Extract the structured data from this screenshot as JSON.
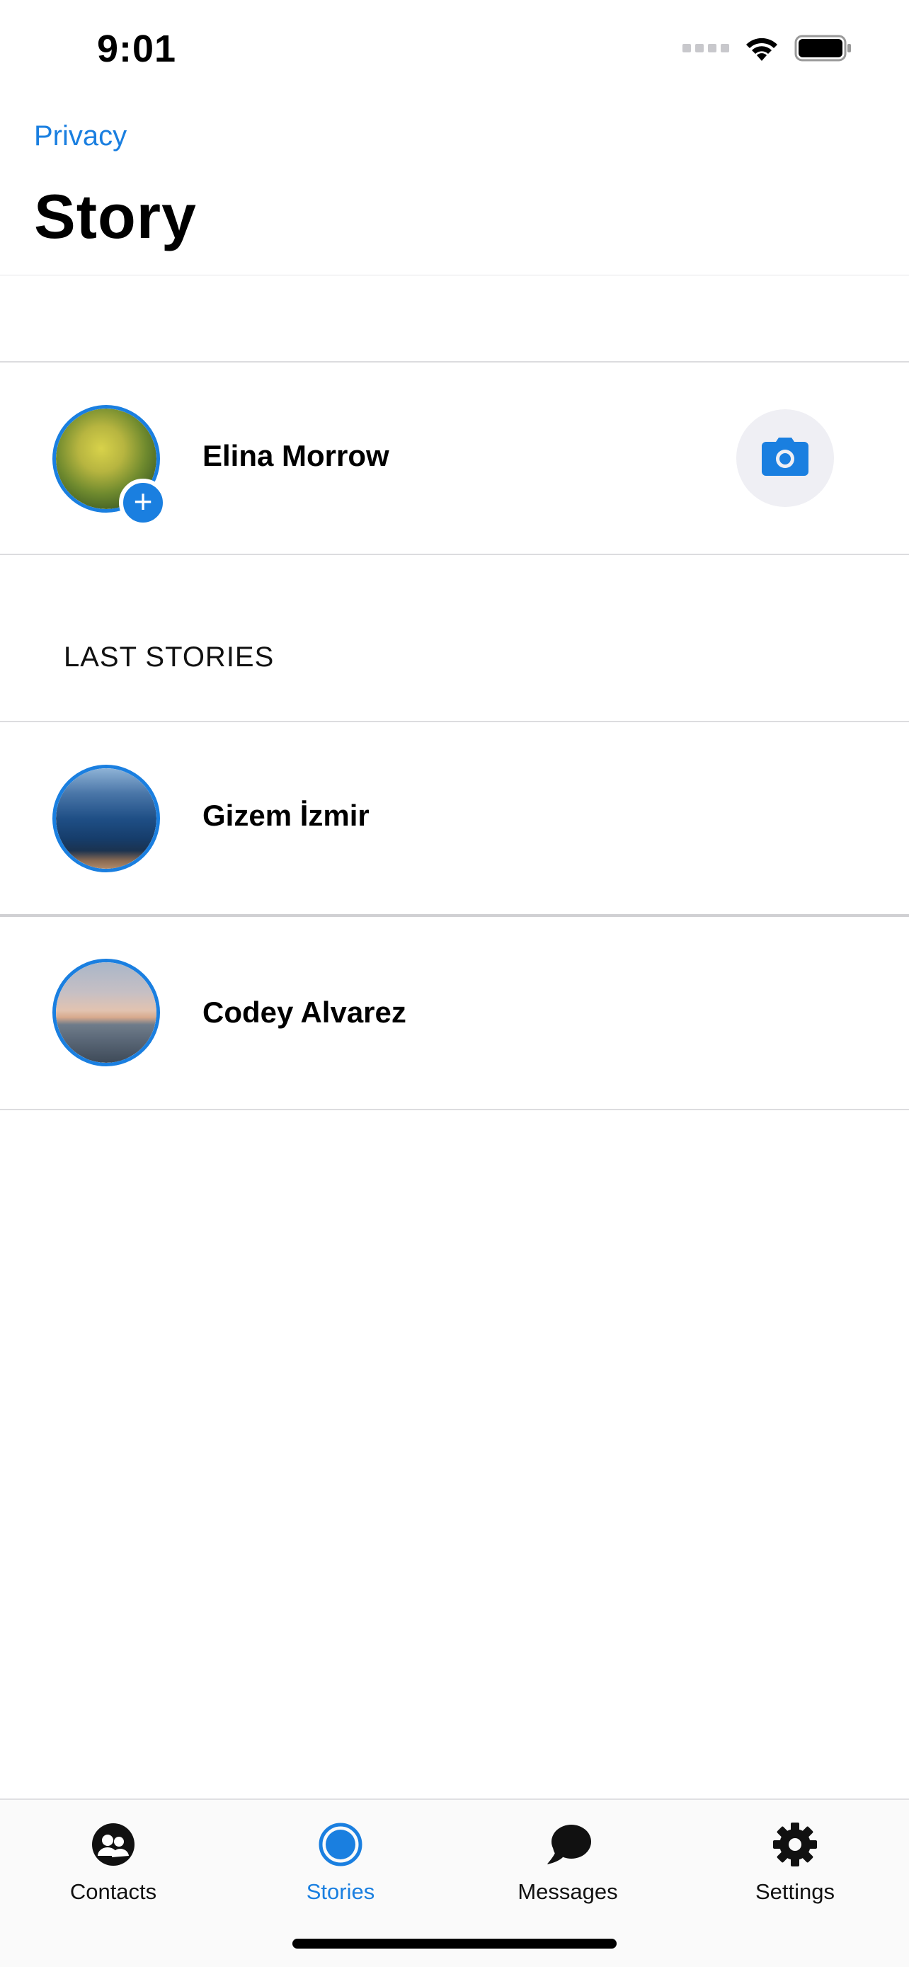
{
  "status_bar": {
    "time": "9:01"
  },
  "header": {
    "back_link": "Privacy",
    "title": "Story"
  },
  "my_story": {
    "name": "Elina Morrow",
    "add_badge": "+",
    "camera_icon": "camera-icon"
  },
  "section": {
    "last_stories_title": "LAST STORIES"
  },
  "stories": [
    {
      "name": "Gizem İzmir"
    },
    {
      "name": "Codey Alvarez"
    }
  ],
  "tab_bar": {
    "tabs": [
      {
        "label": "Contacts",
        "icon": "contacts-icon",
        "active": false
      },
      {
        "label": "Stories",
        "icon": "stories-icon",
        "active": true
      },
      {
        "label": "Messages",
        "icon": "messages-icon",
        "active": false
      },
      {
        "label": "Settings",
        "icon": "settings-icon",
        "active": false
      }
    ]
  },
  "colors": {
    "accent": "#1a7fe0",
    "camera_bg": "#efeff4"
  }
}
